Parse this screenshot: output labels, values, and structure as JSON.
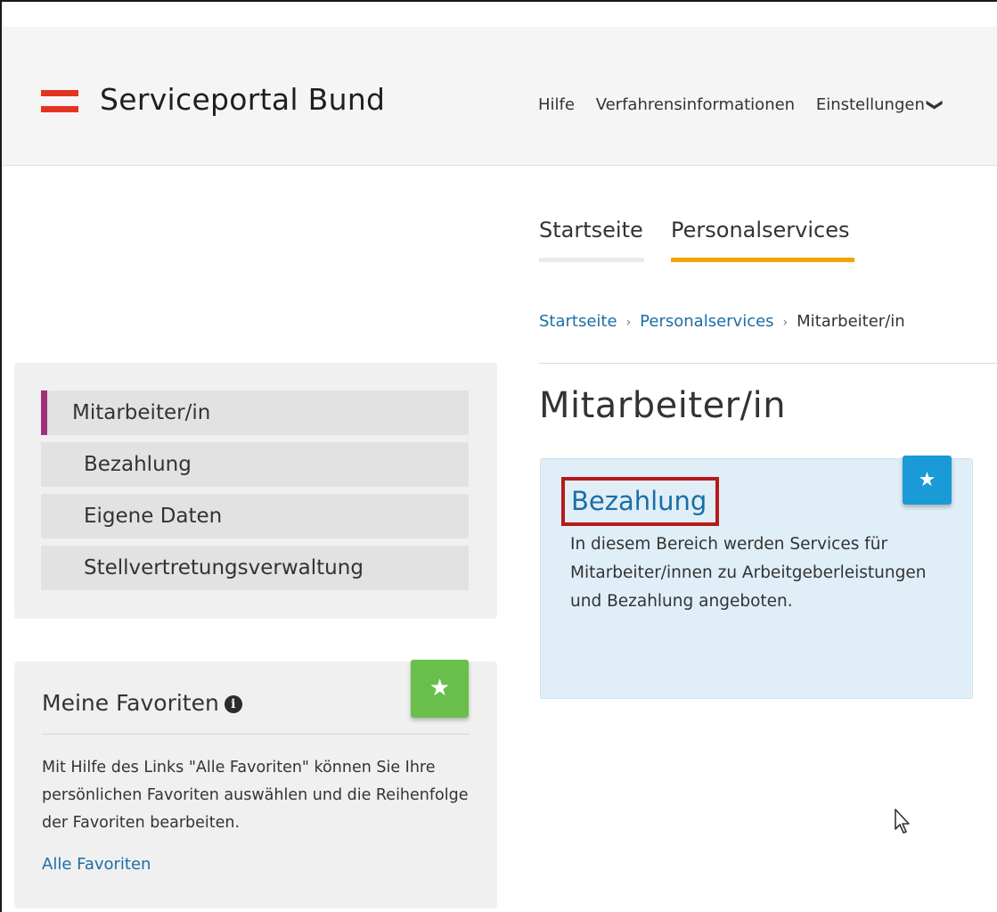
{
  "header": {
    "logo_text": "Serviceportal Bund",
    "nav": [
      "Hilfe",
      "Verfahrensinformationen",
      "Einstellungen"
    ],
    "settings_chevron": "❯"
  },
  "tabs": [
    {
      "label": "Startseite",
      "active": false
    },
    {
      "label": "Personalservices",
      "active": true
    }
  ],
  "breadcrumb": {
    "items": [
      "Startseite",
      "Personalservices",
      "Mitarbeiter/in"
    ],
    "separator": "›"
  },
  "page_title": "Mitarbeiter/in",
  "subnav": {
    "items": [
      "Mitarbeiter/in",
      "Bezahlung",
      "Eigene Daten",
      "Stellvertretungsverwaltung"
    ],
    "active_color": "#a0307a"
  },
  "favorites": {
    "title": "Meine Favoriten",
    "info_glyph": "i",
    "text": "Mit Hilfe des Links \"Alle Favoriten\" können Sie Ihre persönlichen Favoriten auswählen und die Reihenfolge der Favoriten bearbeiten.",
    "link": "Alle Favoriten",
    "star_color": "#6abf4b"
  },
  "card": {
    "title": "Bezahlung",
    "description": "In diesem Bereich werden Services für Mitarbeiter/innen zu Arbeitgeberleistungen und Bezahlung angeboten.",
    "highlight_color": "#b41a1a",
    "star_color": "#1a9ad6"
  },
  "icons": {
    "star": "★",
    "logo": "austria-flag-logo-icon",
    "cursor": "mouse-pointer-icon"
  },
  "colors": {
    "accent_tab": "#f0a500",
    "link": "#1a6ea8",
    "logo_red": "#e4341f"
  }
}
